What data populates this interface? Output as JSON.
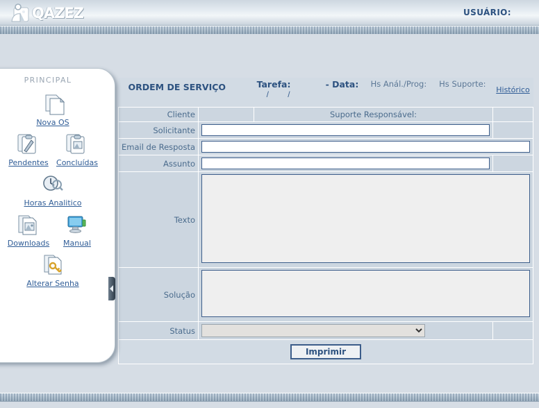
{
  "header": {
    "logo_text": "QAZEZ",
    "logo_icon": "people-photo-icon",
    "user_label": "USUÁRIO:"
  },
  "sidebar": {
    "title": "PRINCIPAL",
    "collapse_handle": "collapse-arrow-icon",
    "items": [
      {
        "label": "Nova OS",
        "icon": "new-document-icon"
      },
      {
        "label": "Pendentes",
        "icon": "pending-clipboard-icon"
      },
      {
        "label": "Concluídas",
        "icon": "completed-clipboard-icon"
      },
      {
        "label": "Horas Analitico",
        "icon": "clock-search-icon"
      },
      {
        "label": "Downloads",
        "icon": "download-documents-icon"
      },
      {
        "label": "Manual",
        "icon": "computer-monitor-icon"
      },
      {
        "label": "Alterar Senha",
        "icon": "key-document-icon"
      }
    ]
  },
  "form": {
    "title": "ORDEM DE SERVIÇO",
    "task_label": "Tarefa:",
    "task_value": "",
    "task_slashes": "/  /",
    "date_label": "- Data:",
    "date_value": "",
    "hours_analysis_label": "Hs Anál./Prog:",
    "hours_analysis_value": "",
    "hours_support_label": "Hs Suporte:",
    "hours_support_value": "",
    "history_link": "Histórico",
    "client_label": "Cliente",
    "client_value": "",
    "support_responsible_label": "Suporte Responsável:",
    "support_responsible_value": "",
    "requester_label": "Solicitante",
    "requester_value": "",
    "reply_email_label": "Email de Resposta",
    "reply_email_value": "",
    "subject_label": "Assunto",
    "subject_value": "",
    "text_label": "Texto",
    "text_value": "",
    "solution_label": "Solução",
    "solution_value": "",
    "status_label": "Status",
    "status_value": "",
    "status_options": [
      ""
    ],
    "print_button": "Imprimir"
  },
  "colors": {
    "page_bg": "#d6dde5",
    "label_cell": "#ccd6e0",
    "header_cell": "#d2dbe4",
    "link": "#2f5c96",
    "accent_text": "#2d5280",
    "field_border": "#3c5d8a",
    "textarea_bg": "#efefef"
  }
}
